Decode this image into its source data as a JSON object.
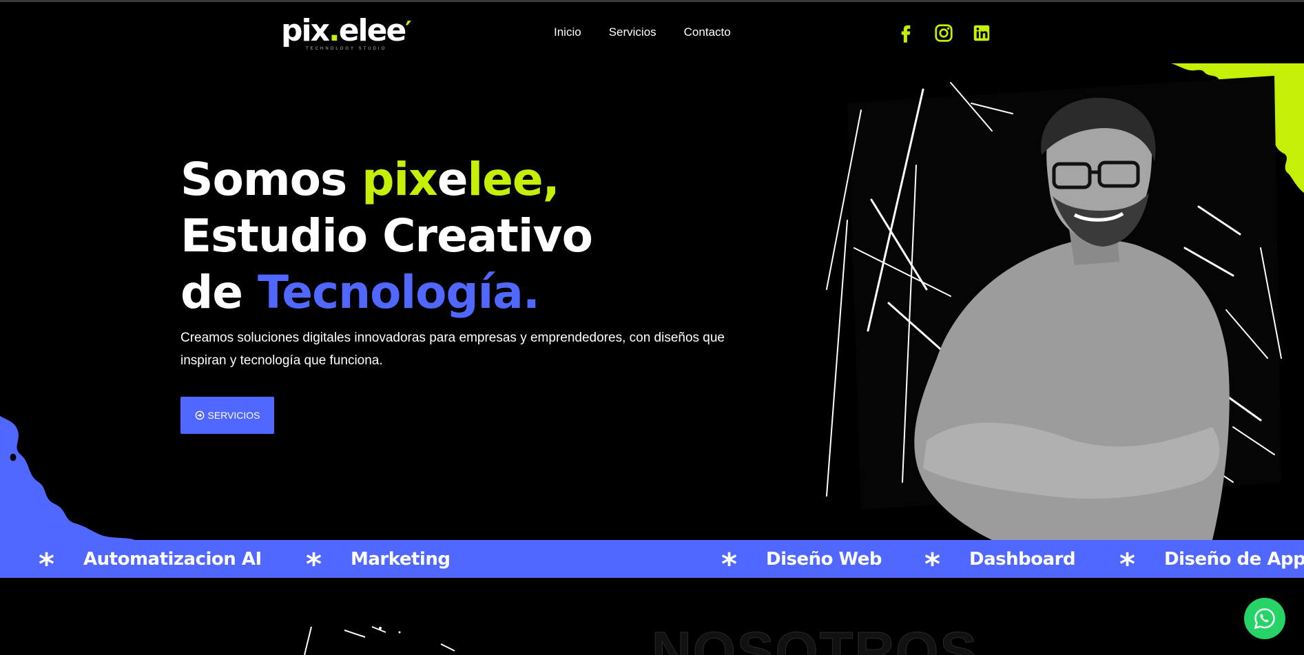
{
  "colors": {
    "accent_green": "#c6ef07",
    "accent_blue": "#5068ff",
    "background": "#000000",
    "whatsapp_green": "#25d366"
  },
  "header": {
    "logo_text": "pixelee",
    "logo_tagline": "TECHNOLOGY STUDIO",
    "nav": [
      {
        "label": "Inicio"
      },
      {
        "label": "Servicios"
      },
      {
        "label": "Contacto"
      }
    ],
    "social_icons": [
      "facebook-icon",
      "instagram-icon",
      "linkedin-icon"
    ]
  },
  "hero": {
    "title_line1_a": "Somos ",
    "title_line1_b": "pix",
    "title_line1_c": "e",
    "title_line1_d": "lee,",
    "title_line2": "Estudio Creativo",
    "title_line3_a": "de ",
    "title_line3_b": "Tecnología.",
    "description": "Creamos soluciones digitales innovadoras para empresas y emprendedores, con diseños que inspiran y tecnología que funciona.",
    "button_label": "SERVICIOS",
    "button_icon": "arrow-circle-right-icon"
  },
  "marquee": {
    "items": [
      {
        "label": "Automatizacion AI"
      },
      {
        "label": "Marketing"
      },
      {
        "label": "Diseño Web"
      },
      {
        "label": "Dashboard"
      },
      {
        "label": "Diseño de App"
      }
    ],
    "separator": "*"
  },
  "section": {
    "title": "NOSOTROS"
  },
  "whatsapp": {
    "icon": "whatsapp-icon"
  }
}
